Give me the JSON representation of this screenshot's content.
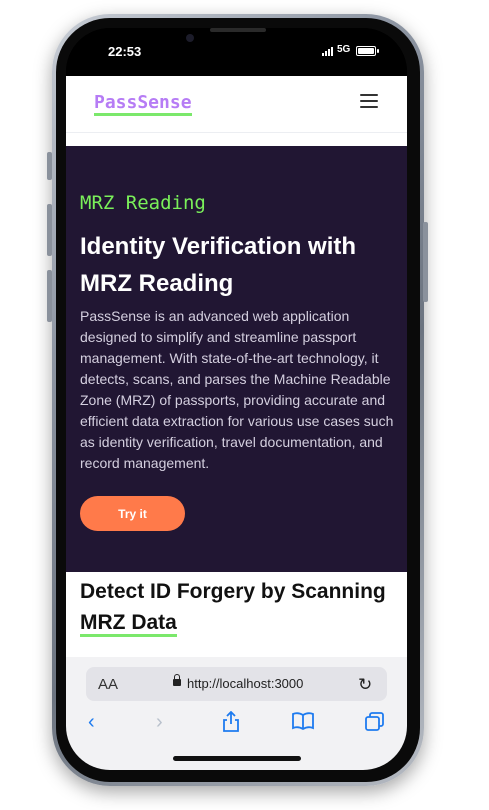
{
  "status": {
    "time": "22:53",
    "network": "5G"
  },
  "site": {
    "logo": "PassSense",
    "hero": {
      "eyebrow": "MRZ Reading",
      "headline": "Identity Verification with MRZ Reading",
      "description": "PassSense is an advanced web application designed to simplify and streamline passport management. With state-of-the-art technology, it detects, scans, and parses the Machine Readable Zone (MRZ) of passports, providing accurate and efficient data extraction for various use cases such as identity verification, travel documentation, and record management.",
      "cta_label": "Try it"
    },
    "section": {
      "title_part1": "Detect ID Forgery by Scanning ",
      "title_part2": "MRZ Data"
    }
  },
  "browser": {
    "text_size_label": "AA",
    "url": "http://localhost:3000",
    "icons": [
      "back-icon",
      "forward-icon",
      "share-icon",
      "bookmarks-icon",
      "tabs-icon",
      "reload-icon",
      "lock-icon",
      "menu-icon"
    ]
  },
  "colors": {
    "accent_purple": "#b67cf5",
    "accent_green": "#7be86b",
    "hero_bg": "#211633",
    "cta": "#ff7a4a"
  }
}
